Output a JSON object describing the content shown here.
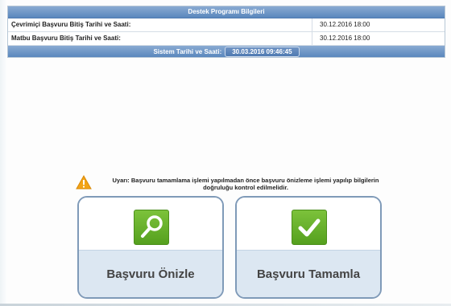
{
  "info": {
    "header": "Destek Programı Bilgileri",
    "rows": [
      {
        "label": "Çevrimiçi Başvuru Bitiş Tarihi ve Saati:",
        "value": "30.12.2016 18:00"
      },
      {
        "label": "Matbu Başvuru Bitiş Tarihi ve Saati:",
        "value": "30.12.2016 18:00"
      }
    ],
    "system_label": "Sistem Tarihi ve Saati:",
    "system_value": "30.03.2016 09:46:45"
  },
  "warning": {
    "icon": "warning-triangle-icon",
    "text": "Uyarı: Başvuru tamamlama işlemi yapılmadan önce başvuru önizleme işlemi yapılıp bilgilerin doğruluğu kontrol edilmelidir."
  },
  "actions": {
    "preview_label": "Başvuru Önizle",
    "preview_icon": "magnifier-icon",
    "complete_label": "Başvuru Tamamla",
    "complete_icon": "checkmark-icon"
  },
  "colors": {
    "header_blue": "#5a87bd",
    "tile_green": "#6ab52f",
    "button_border": "#7f9ab8",
    "button_bottom": "#dce7f2"
  }
}
